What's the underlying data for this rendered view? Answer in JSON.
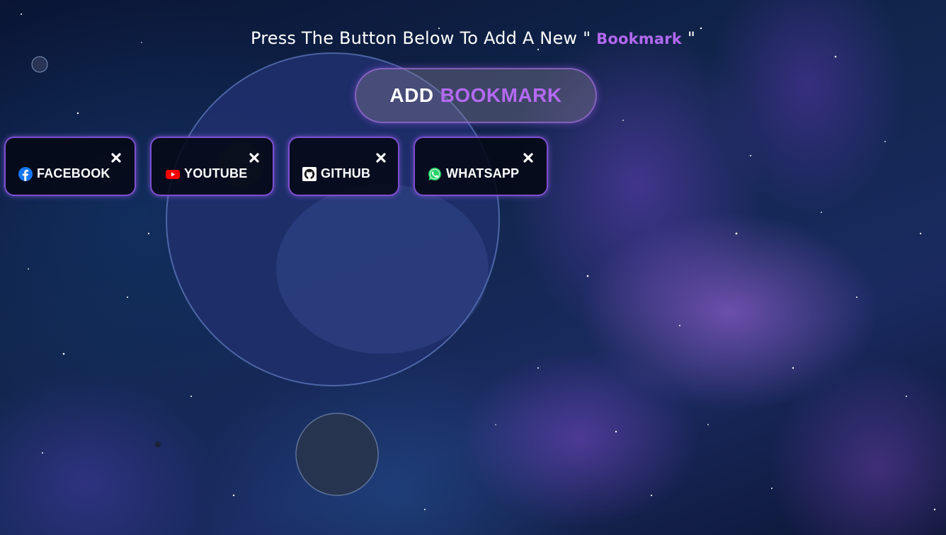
{
  "heading": {
    "prefix": "Press The Button Below To Add A New \"",
    "accent": "Bookmark",
    "suffix": " \""
  },
  "add_button": {
    "word1": "ADD",
    "word2": "BOOKMARK"
  },
  "bookmarks": [
    {
      "label": "FACEBOOK",
      "icon": "facebook-icon"
    },
    {
      "label": "YOUTUBE",
      "icon": "youtube-icon"
    },
    {
      "label": "GITHUB",
      "icon": "github-icon"
    },
    {
      "label": "WHATSAPP",
      "icon": "whatsapp-icon"
    }
  ],
  "colors": {
    "accent_purple": "#b569f2",
    "card_border": "#7d4fcf",
    "card_background": "#05081a",
    "facebook_blue": "#1877f2",
    "youtube_red": "#ff0000",
    "whatsapp_green": "#25d366"
  }
}
